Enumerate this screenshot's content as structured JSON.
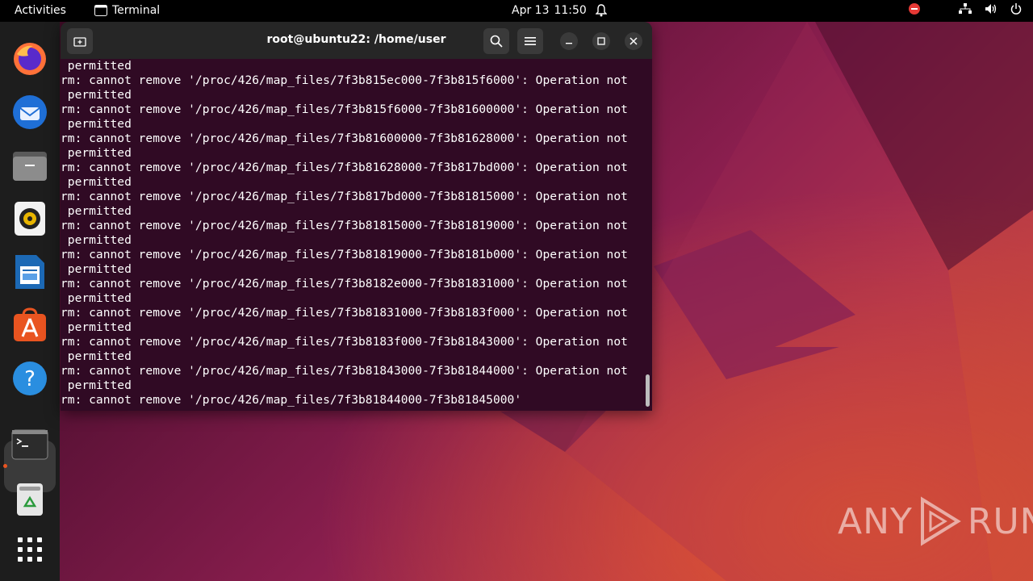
{
  "topbar": {
    "activities": "Activities",
    "app_name": "Terminal",
    "date": "Apr 13",
    "time": "11:50"
  },
  "dock": {
    "items": [
      "firefox-icon",
      "thunderbird-icon",
      "files-icon",
      "rhythmbox-icon",
      "libreoffice-writer-icon",
      "app-center-icon",
      "help-icon",
      "terminal-icon",
      "trash-icon",
      "show-apps-icon"
    ]
  },
  "terminal": {
    "title": "root@ubuntu22: /home/user",
    "lines": [
      " permitted",
      "rm: cannot remove '/proc/426/map_files/7f3b815ec000-7f3b815f6000': Operation not",
      " permitted",
      "rm: cannot remove '/proc/426/map_files/7f3b815f6000-7f3b81600000': Operation not",
      " permitted",
      "rm: cannot remove '/proc/426/map_files/7f3b81600000-7f3b81628000': Operation not",
      " permitted",
      "rm: cannot remove '/proc/426/map_files/7f3b81628000-7f3b817bd000': Operation not",
      " permitted",
      "rm: cannot remove '/proc/426/map_files/7f3b817bd000-7f3b81815000': Operation not",
      " permitted",
      "rm: cannot remove '/proc/426/map_files/7f3b81815000-7f3b81819000': Operation not",
      " permitted",
      "rm: cannot remove '/proc/426/map_files/7f3b81819000-7f3b8181b000': Operation not",
      " permitted",
      "rm: cannot remove '/proc/426/map_files/7f3b8182e000-7f3b81831000': Operation not",
      " permitted",
      "rm: cannot remove '/proc/426/map_files/7f3b81831000-7f3b8183f000': Operation not",
      " permitted",
      "rm: cannot remove '/proc/426/map_files/7f3b8183f000-7f3b81843000': Operation not",
      " permitted",
      "rm: cannot remove '/proc/426/map_files/7f3b81843000-7f3b81844000': Operation not",
      " permitted",
      "rm: cannot remove '/proc/426/map_files/7f3b81844000-7f3b81845000'"
    ]
  },
  "watermark": {
    "left": "ANY",
    "right": "RUN"
  },
  "colors": {
    "terminal_bg": "#300a24",
    "accent": "#e95420"
  }
}
